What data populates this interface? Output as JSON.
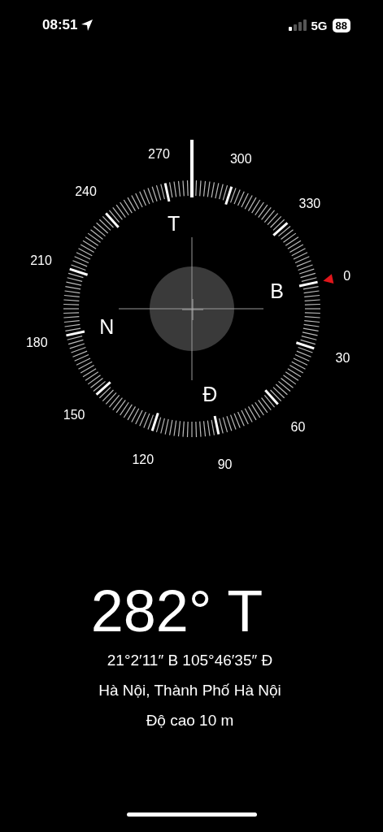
{
  "status_bar": {
    "time": "08:51",
    "network": "5G",
    "battery": "88"
  },
  "compass": {
    "degree_labels": [
      "0",
      "30",
      "60",
      "90",
      "120",
      "150",
      "180",
      "210",
      "240",
      "270",
      "300",
      "330"
    ],
    "cardinal_labels": [
      "B",
      "Đ",
      "N",
      "T"
    ]
  },
  "heading": "282° T",
  "coordinates": "21°2′11″ B  105°46′35″ Đ",
  "place": "Hà Nội, Thành Phố Hà Nội",
  "altitude": "Độ cao 10 m"
}
